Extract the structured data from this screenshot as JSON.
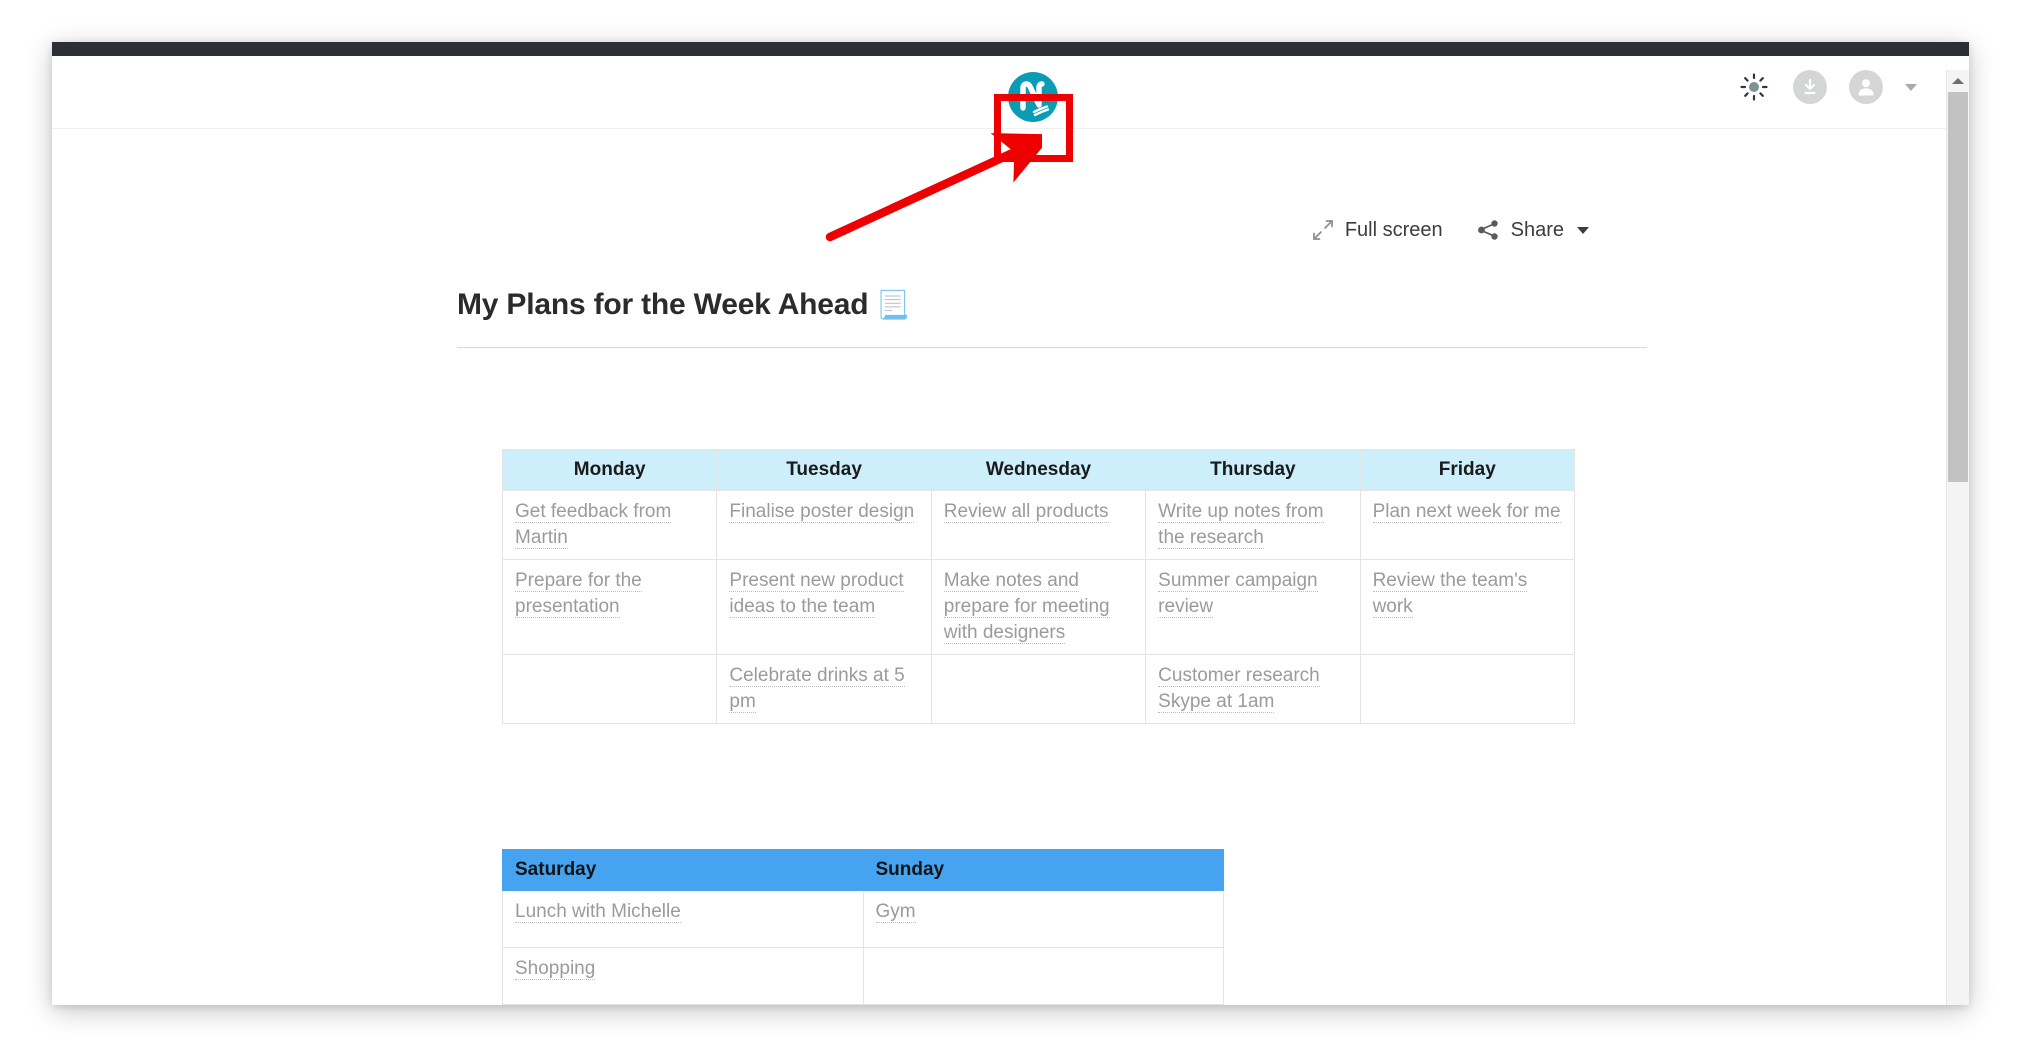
{
  "window": {
    "titlebar_color": "#2c2f34"
  },
  "appbar": {
    "logo": {
      "name": "nimbus-note-logo",
      "letter": "N",
      "bg_color": "#0b9cb5"
    },
    "right_icons": [
      {
        "name": "brightness-icon",
        "label": "Brightness"
      },
      {
        "name": "download-icon",
        "label": "Download"
      },
      {
        "name": "account-avatar-icon",
        "label": "Account"
      },
      {
        "name": "account-caret-icon",
        "label": "Account menu"
      }
    ]
  },
  "doc_toolbar": {
    "fullscreen_label": "Full screen",
    "share_label": "Share"
  },
  "document": {
    "title": "My Plans for the Week Ahead",
    "title_emoji": "📃"
  },
  "week_table": {
    "header_bg": "#cdeefb",
    "headers": [
      "Monday",
      "Tuesday",
      "Wednesday",
      "Thursday",
      "Friday"
    ],
    "rows": [
      [
        "Get feedback from Martin",
        "Finalise poster design",
        "Review all products",
        "Write up notes from the research",
        "Plan next week for me"
      ],
      [
        "Prepare for the presentation",
        "Present new product ideas to the team",
        "Make notes and prepare for meeting with designers",
        "Summer campaign review",
        "Review the team's work"
      ],
      [
        "",
        "Celebrate drinks at 5 pm",
        "",
        "Customer research Skype at 1am",
        ""
      ]
    ]
  },
  "weekend_table": {
    "header_bg": "#46a3f0",
    "headers": [
      "Saturday",
      "Sunday"
    ],
    "rows": [
      [
        "Lunch with Michelle",
        "Gym"
      ],
      [
        "Shopping",
        ""
      ]
    ]
  },
  "annotation": {
    "color": "#ef0000",
    "target": "nimbus-note-logo"
  },
  "scrollbar": {
    "orientation": "vertical"
  }
}
